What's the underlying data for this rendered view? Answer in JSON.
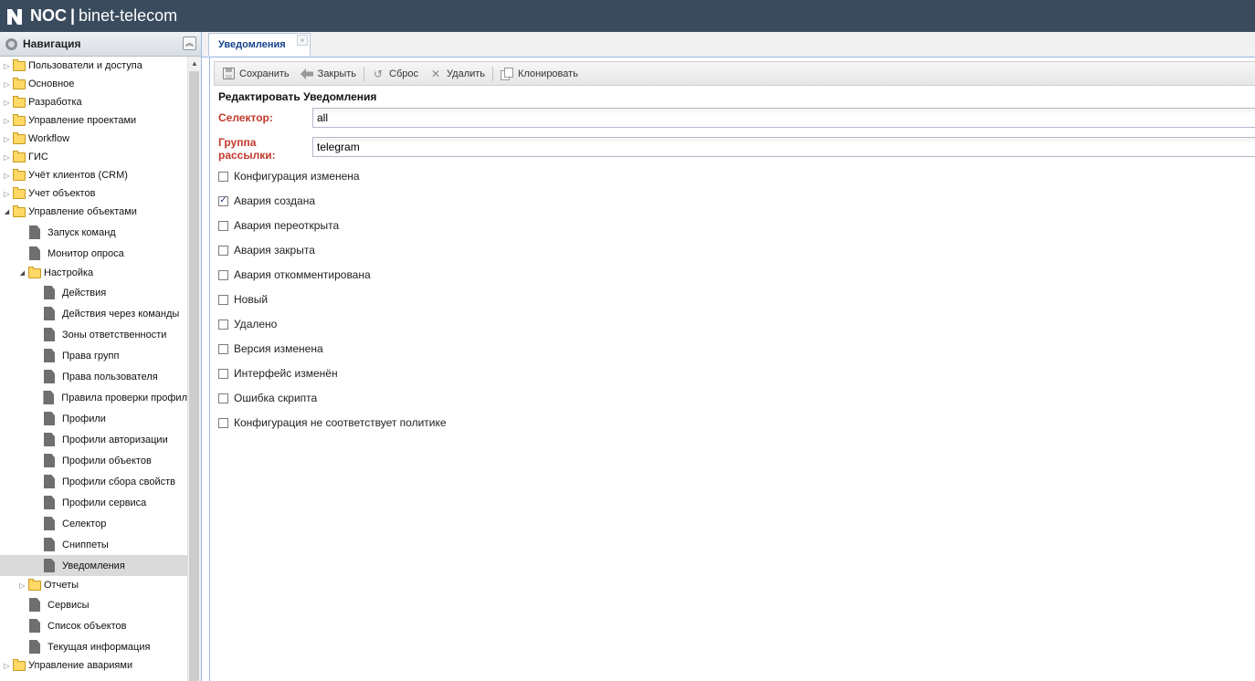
{
  "header": {
    "brand": "NOC",
    "separator": "|",
    "org": "binet-telecom"
  },
  "nav": {
    "title": "Навигация",
    "items": [
      {
        "label": "Пользователи и доступа",
        "type": "folder",
        "state": "collapsed"
      },
      {
        "label": "Основное",
        "type": "folder",
        "state": "collapsed"
      },
      {
        "label": "Разработка",
        "type": "folder",
        "state": "collapsed"
      },
      {
        "label": "Управление проектами",
        "type": "folder",
        "state": "collapsed"
      },
      {
        "label": "Workflow",
        "type": "folder",
        "state": "collapsed"
      },
      {
        "label": "ГИС",
        "type": "folder",
        "state": "collapsed"
      },
      {
        "label": "Учёт клиентов (CRM)",
        "type": "folder",
        "state": "collapsed"
      },
      {
        "label": "Учет объектов",
        "type": "folder",
        "state": "collapsed"
      },
      {
        "label": "Управление объектами",
        "type": "folder",
        "state": "expanded"
      },
      {
        "label": "Запуск команд",
        "type": "leaf"
      },
      {
        "label": "Монитор опроса",
        "type": "leaf"
      },
      {
        "label": "Настройка",
        "type": "folder",
        "state": "expanded"
      },
      {
        "label": "Действия",
        "type": "leaf"
      },
      {
        "label": "Действия через команды",
        "type": "leaf"
      },
      {
        "label": "Зоны ответственности",
        "type": "leaf"
      },
      {
        "label": "Права групп",
        "type": "leaf"
      },
      {
        "label": "Права пользователя",
        "type": "leaf"
      },
      {
        "label": "Правила проверки профил",
        "type": "leaf"
      },
      {
        "label": "Профили",
        "type": "leaf"
      },
      {
        "label": "Профили авторизации",
        "type": "leaf"
      },
      {
        "label": "Профили объектов",
        "type": "leaf"
      },
      {
        "label": "Профили сбора свойств",
        "type": "leaf"
      },
      {
        "label": "Профили сервиса",
        "type": "leaf"
      },
      {
        "label": "Селектор",
        "type": "leaf"
      },
      {
        "label": "Сниппеты",
        "type": "leaf"
      },
      {
        "label": "Уведомления",
        "type": "leaf",
        "selected": true
      },
      {
        "label": "Отчеты",
        "type": "folder",
        "state": "collapsed"
      },
      {
        "label": "Сервисы",
        "type": "leaf"
      },
      {
        "label": "Список объектов",
        "type": "leaf"
      },
      {
        "label": "Текущая информация",
        "type": "leaf"
      },
      {
        "label": "Управление авариями",
        "type": "folder",
        "state": "collapsed"
      }
    ]
  },
  "tab": {
    "label": "Уведомления"
  },
  "toolbar": {
    "save": "Сохранить",
    "close": "Закрыть",
    "reset": "Сброс",
    "delete": "Удалить",
    "clone": "Клонировать"
  },
  "form": {
    "title": "Редактировать Уведомления",
    "selector_label": "Селектор:",
    "selector_value": "all",
    "group_label_line1": "Группа",
    "group_label_line2": "рассылки:",
    "group_value": "telegram",
    "checkboxes": [
      {
        "label": "Конфигурация изменена",
        "checked": false
      },
      {
        "label": "Авария создана",
        "checked": true
      },
      {
        "label": "Авария переоткрыта",
        "checked": false
      },
      {
        "label": "Авария закрыта",
        "checked": false
      },
      {
        "label": "Авария откомментирована",
        "checked": false
      },
      {
        "label": "Новый",
        "checked": false
      },
      {
        "label": "Удалено",
        "checked": false
      },
      {
        "label": "Версия изменена",
        "checked": false
      },
      {
        "label": "Интерфейс изменён",
        "checked": false
      },
      {
        "label": "Ошибка скрипта",
        "checked": false
      },
      {
        "label": "Конфигурация не соответствует политике",
        "checked": false
      }
    ]
  }
}
